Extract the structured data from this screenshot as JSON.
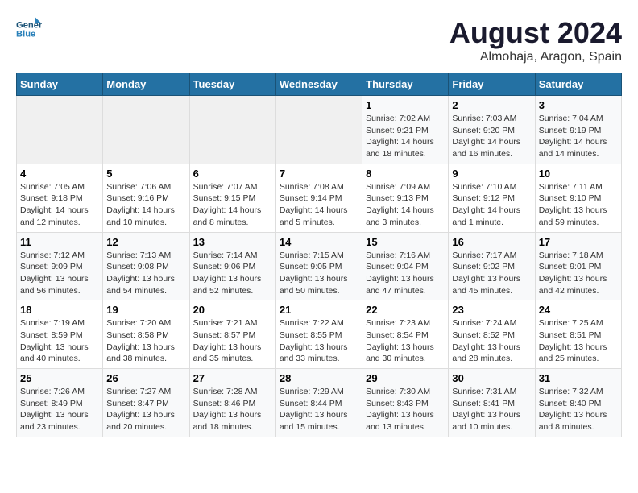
{
  "header": {
    "logo_line1": "General",
    "logo_line2": "Blue",
    "title": "August 2024",
    "subtitle": "Almohaja, Aragon, Spain"
  },
  "weekdays": [
    "Sunday",
    "Monday",
    "Tuesday",
    "Wednesday",
    "Thursday",
    "Friday",
    "Saturday"
  ],
  "weeks": [
    [
      {
        "day": "",
        "info": ""
      },
      {
        "day": "",
        "info": ""
      },
      {
        "day": "",
        "info": ""
      },
      {
        "day": "",
        "info": ""
      },
      {
        "day": "1",
        "info": "Sunrise: 7:02 AM\nSunset: 9:21 PM\nDaylight: 14 hours\nand 18 minutes."
      },
      {
        "day": "2",
        "info": "Sunrise: 7:03 AM\nSunset: 9:20 PM\nDaylight: 14 hours\nand 16 minutes."
      },
      {
        "day": "3",
        "info": "Sunrise: 7:04 AM\nSunset: 9:19 PM\nDaylight: 14 hours\nand 14 minutes."
      }
    ],
    [
      {
        "day": "4",
        "info": "Sunrise: 7:05 AM\nSunset: 9:18 PM\nDaylight: 14 hours\nand 12 minutes."
      },
      {
        "day": "5",
        "info": "Sunrise: 7:06 AM\nSunset: 9:16 PM\nDaylight: 14 hours\nand 10 minutes."
      },
      {
        "day": "6",
        "info": "Sunrise: 7:07 AM\nSunset: 9:15 PM\nDaylight: 14 hours\nand 8 minutes."
      },
      {
        "day": "7",
        "info": "Sunrise: 7:08 AM\nSunset: 9:14 PM\nDaylight: 14 hours\nand 5 minutes."
      },
      {
        "day": "8",
        "info": "Sunrise: 7:09 AM\nSunset: 9:13 PM\nDaylight: 14 hours\nand 3 minutes."
      },
      {
        "day": "9",
        "info": "Sunrise: 7:10 AM\nSunset: 9:12 PM\nDaylight: 14 hours\nand 1 minute."
      },
      {
        "day": "10",
        "info": "Sunrise: 7:11 AM\nSunset: 9:10 PM\nDaylight: 13 hours\nand 59 minutes."
      }
    ],
    [
      {
        "day": "11",
        "info": "Sunrise: 7:12 AM\nSunset: 9:09 PM\nDaylight: 13 hours\nand 56 minutes."
      },
      {
        "day": "12",
        "info": "Sunrise: 7:13 AM\nSunset: 9:08 PM\nDaylight: 13 hours\nand 54 minutes."
      },
      {
        "day": "13",
        "info": "Sunrise: 7:14 AM\nSunset: 9:06 PM\nDaylight: 13 hours\nand 52 minutes."
      },
      {
        "day": "14",
        "info": "Sunrise: 7:15 AM\nSunset: 9:05 PM\nDaylight: 13 hours\nand 50 minutes."
      },
      {
        "day": "15",
        "info": "Sunrise: 7:16 AM\nSunset: 9:04 PM\nDaylight: 13 hours\nand 47 minutes."
      },
      {
        "day": "16",
        "info": "Sunrise: 7:17 AM\nSunset: 9:02 PM\nDaylight: 13 hours\nand 45 minutes."
      },
      {
        "day": "17",
        "info": "Sunrise: 7:18 AM\nSunset: 9:01 PM\nDaylight: 13 hours\nand 42 minutes."
      }
    ],
    [
      {
        "day": "18",
        "info": "Sunrise: 7:19 AM\nSunset: 8:59 PM\nDaylight: 13 hours\nand 40 minutes."
      },
      {
        "day": "19",
        "info": "Sunrise: 7:20 AM\nSunset: 8:58 PM\nDaylight: 13 hours\nand 38 minutes."
      },
      {
        "day": "20",
        "info": "Sunrise: 7:21 AM\nSunset: 8:57 PM\nDaylight: 13 hours\nand 35 minutes."
      },
      {
        "day": "21",
        "info": "Sunrise: 7:22 AM\nSunset: 8:55 PM\nDaylight: 13 hours\nand 33 minutes."
      },
      {
        "day": "22",
        "info": "Sunrise: 7:23 AM\nSunset: 8:54 PM\nDaylight: 13 hours\nand 30 minutes."
      },
      {
        "day": "23",
        "info": "Sunrise: 7:24 AM\nSunset: 8:52 PM\nDaylight: 13 hours\nand 28 minutes."
      },
      {
        "day": "24",
        "info": "Sunrise: 7:25 AM\nSunset: 8:51 PM\nDaylight: 13 hours\nand 25 minutes."
      }
    ],
    [
      {
        "day": "25",
        "info": "Sunrise: 7:26 AM\nSunset: 8:49 PM\nDaylight: 13 hours\nand 23 minutes."
      },
      {
        "day": "26",
        "info": "Sunrise: 7:27 AM\nSunset: 8:47 PM\nDaylight: 13 hours\nand 20 minutes."
      },
      {
        "day": "27",
        "info": "Sunrise: 7:28 AM\nSunset: 8:46 PM\nDaylight: 13 hours\nand 18 minutes."
      },
      {
        "day": "28",
        "info": "Sunrise: 7:29 AM\nSunset: 8:44 PM\nDaylight: 13 hours\nand 15 minutes."
      },
      {
        "day": "29",
        "info": "Sunrise: 7:30 AM\nSunset: 8:43 PM\nDaylight: 13 hours\nand 13 minutes."
      },
      {
        "day": "30",
        "info": "Sunrise: 7:31 AM\nSunset: 8:41 PM\nDaylight: 13 hours\nand 10 minutes."
      },
      {
        "day": "31",
        "info": "Sunrise: 7:32 AM\nSunset: 8:40 PM\nDaylight: 13 hours\nand 8 minutes."
      }
    ]
  ]
}
